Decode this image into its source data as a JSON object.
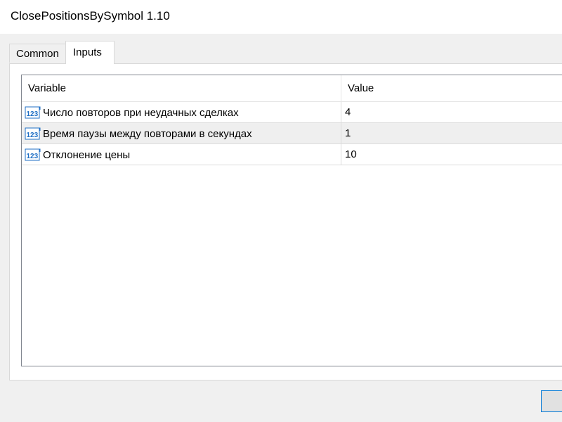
{
  "window": {
    "title": "ClosePositionsBySymbol 1.10"
  },
  "tabs": [
    {
      "label": "Common",
      "active": false
    },
    {
      "label": "Inputs",
      "active": true
    }
  ],
  "grid": {
    "columns": [
      "Variable",
      "Value"
    ],
    "rows": [
      {
        "icon": "integer-123-icon",
        "variable": "Число повторов при неудачных сделках",
        "value": "4"
      },
      {
        "icon": "integer-123-icon",
        "variable": "Время паузы между повторами в секундах",
        "value": "1"
      },
      {
        "icon": "integer-123-icon",
        "variable": "Отклонение цены",
        "value": "10"
      }
    ]
  },
  "colors": {
    "icon_blue": "#1f6fc5",
    "accent_border": "#0078d7"
  }
}
